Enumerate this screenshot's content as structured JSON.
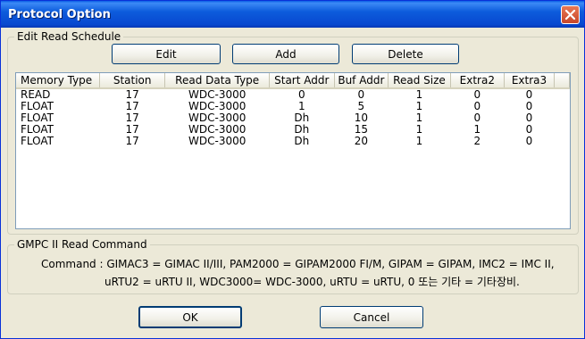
{
  "window": {
    "title": "Protocol Option"
  },
  "read_schedule": {
    "legend": "Edit Read Schedule",
    "buttons": {
      "edit": "Edit",
      "add": "Add",
      "delete": "Delete"
    },
    "columns": [
      "Memory Type",
      "Station",
      "Read Data Type",
      "Start Addr",
      "Buf Addr",
      "Read Size",
      "Extra2",
      "Extra3"
    ],
    "rows": [
      [
        "READ",
        "17",
        "WDC-3000",
        "0",
        "0",
        "1",
        "0",
        "0"
      ],
      [
        "FLOAT",
        "17",
        "WDC-3000",
        "1",
        "5",
        "1",
        "0",
        "0"
      ],
      [
        "FLOAT",
        "17",
        "WDC-3000",
        "Dh",
        "10",
        "1",
        "0",
        "0"
      ],
      [
        "FLOAT",
        "17",
        "WDC-3000",
        "Dh",
        "15",
        "1",
        "1",
        "0"
      ],
      [
        "FLOAT",
        "17",
        "WDC-3000",
        "Dh",
        "20",
        "1",
        "2",
        "0"
      ]
    ]
  },
  "read_command": {
    "legend": "GMPC II  Read Command",
    "line1": "Command : GIMAC3 = GIMAC II/III, PAM2000 = GIPAM2000 FI/M, GIPAM = GIPAM, IMC2 = IMC II,",
    "line2": "uRTU2 = uRTU II, WDC3000= WDC-3000, uRTU = uRTU, 0 또는 기타 = 기타장비."
  },
  "footer": {
    "ok": "OK",
    "cancel": "Cancel"
  },
  "icons": {
    "close": "close-icon"
  }
}
